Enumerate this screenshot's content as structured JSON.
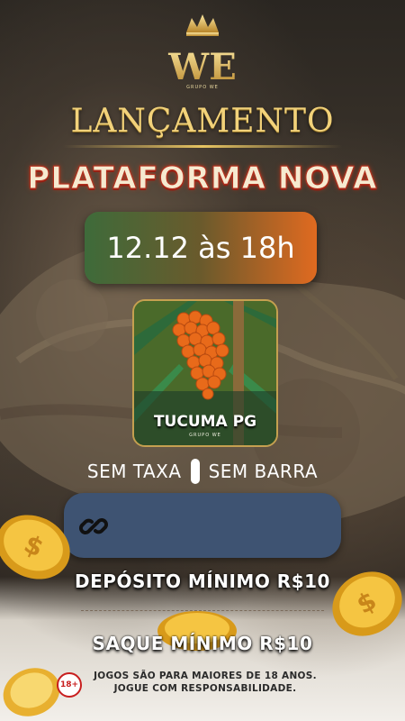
{
  "brand": {
    "logo_text": "WE",
    "logo_sub": "GRUPO WE"
  },
  "headline": {
    "line1": "LANÇAMENTO",
    "line2": "PLATAFORMA NOVA"
  },
  "launch": {
    "date_time": "12.12 às 18h"
  },
  "game": {
    "name": "TUCUMA PG",
    "sub": "GRUPO WE"
  },
  "features": {
    "left": "SEM TAXA",
    "right": "SEM BARRA"
  },
  "link": {
    "icon": "link-icon"
  },
  "limits": {
    "deposit": "DEPÓSITO MÍNIMO R$10",
    "withdraw": "SAQUE MÍNIMO R$10"
  },
  "footer": {
    "age_badge": "18+",
    "line1": "JOGOS SÃO PARA MAIORES DE 18 ANOS.",
    "line2": "JOGUE COM RESPONSABILIDADE."
  },
  "colors": {
    "gold": "#f2d27a",
    "red_outline": "#b3301e",
    "date_start": "#3e6b3a",
    "date_end": "#e06a20",
    "link_bar": "#3e5372",
    "age_red": "#c81e1e"
  }
}
